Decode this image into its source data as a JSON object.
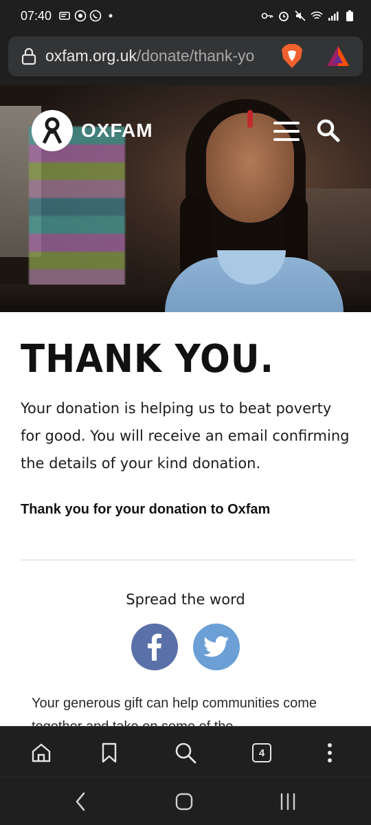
{
  "status_bar": {
    "time": "07:40",
    "left_icons": [
      "message-icon",
      "vpn-icon",
      "whatsapp-icon",
      "dot-icon"
    ],
    "right_icons": [
      "key-icon",
      "alarm-icon",
      "mute-icon",
      "wifi-icon",
      "signal-icon",
      "battery-icon"
    ]
  },
  "browser": {
    "url_host": "oxfam.org.uk",
    "url_path": "/donate/thank-yo",
    "tab_count": "4"
  },
  "header": {
    "logo_text": "OXFAM"
  },
  "main": {
    "title": "THANK YOU.",
    "body": "Your donation is helping us to beat poverty for good. You will receive an email confirming the details of your kind donation.",
    "bold_line": "Thank you for your donation to Oxfam",
    "spread_label": "Spread the word",
    "gift_text": "Your generous gift can help communities come together and take on some of the"
  },
  "colors": {
    "facebook": "#5a70a8",
    "twitter": "#6b9fd6",
    "chrome_dark": "#1f1f1f"
  }
}
